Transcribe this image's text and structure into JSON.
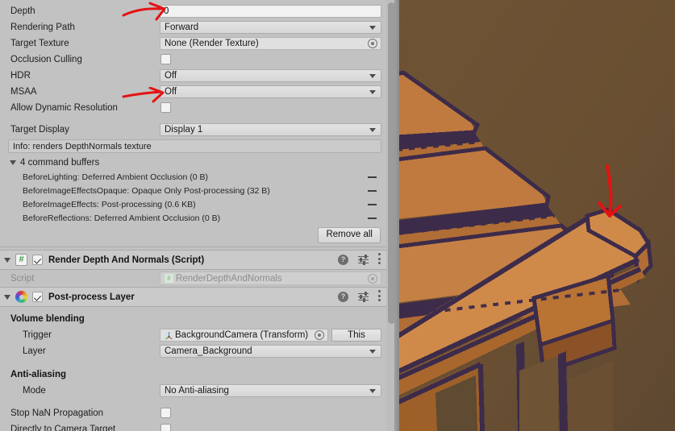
{
  "inspector": {
    "camera_fields": [
      {
        "label": "Depth",
        "type": "text",
        "value": "0"
      },
      {
        "label": "Rendering Path",
        "type": "dropdown",
        "value": "Forward"
      },
      {
        "label": "Target Texture",
        "type": "object",
        "value": "None (Render Texture)"
      },
      {
        "label": "Occlusion Culling",
        "type": "checkbox",
        "value": ""
      },
      {
        "label": "HDR",
        "type": "dropdown",
        "value": "Off"
      },
      {
        "label": "MSAA",
        "type": "dropdown",
        "value": "Off"
      },
      {
        "label": "Allow Dynamic Resolution",
        "type": "checkbox",
        "value": ""
      }
    ],
    "target_display": {
      "label": "Target Display",
      "value": "Display 1"
    },
    "info_box": "Info: renders DepthNormals texture",
    "command_buffers": {
      "foldout_label": "4 command buffers",
      "items": [
        "BeforeLighting: Deferred Ambient Occlusion (0 B)",
        "BeforeImageEffectsOpaque: Opaque Only Post-processing (32 B)",
        "BeforeImageEffects: Post-processing (0.6 KB)",
        "BeforeReflections: Deferred Ambient Occlusion (0 B)"
      ],
      "remove_all_label": "Remove all"
    },
    "components": [
      {
        "title": "Render Depth And Normals (Script)",
        "icon": "csharp-script-icon",
        "enabled": true,
        "script_row": {
          "label": "Script",
          "value": "RenderDepthAndNormals"
        }
      },
      {
        "title": "Post-process Layer",
        "icon": "post-process-layer-icon",
        "enabled": true,
        "volume_blending_header": "Volume blending",
        "trigger": {
          "label": "Trigger",
          "value": "BackgroundCamera (Transform)",
          "button": "This"
        },
        "layer": {
          "label": "Layer",
          "value": "Camera_Background"
        },
        "anti_aliasing_header": "Anti-aliasing",
        "mode": {
          "label": "Mode",
          "value": "No Anti-aliasing"
        },
        "stop_nan": {
          "label": "Stop NaN Propagation",
          "value": ""
        },
        "direct_target": {
          "label": "Directly to Camera Target",
          "value": ""
        }
      }
    ],
    "icons": {
      "help": "?",
      "preset": "preset-icon",
      "kebab": "kebab-menu-icon"
    }
  },
  "game_view": {
    "description": "pixel-art 3D render of wooden stairs",
    "colors": {
      "background": "#6b4f32",
      "plank_light": "#cf8a4a",
      "plank_mid": "#b97433",
      "plank_dark": "#a2612b",
      "plank_shadow": "#8a5226",
      "outline": "#3d2b4a",
      "shadow": "#5b4530"
    }
  },
  "annotations": {
    "arrow_depth": {
      "color": "#e51212",
      "direction": "right",
      "target": "Depth"
    },
    "arrow_msaa": {
      "color": "#e51212",
      "direction": "right",
      "target": "MSAA"
    },
    "arrow_gameview": {
      "color": "#e51212",
      "direction": "down",
      "target": "stair-edge"
    }
  },
  "scrollbar": {
    "orientation": "vertical"
  }
}
